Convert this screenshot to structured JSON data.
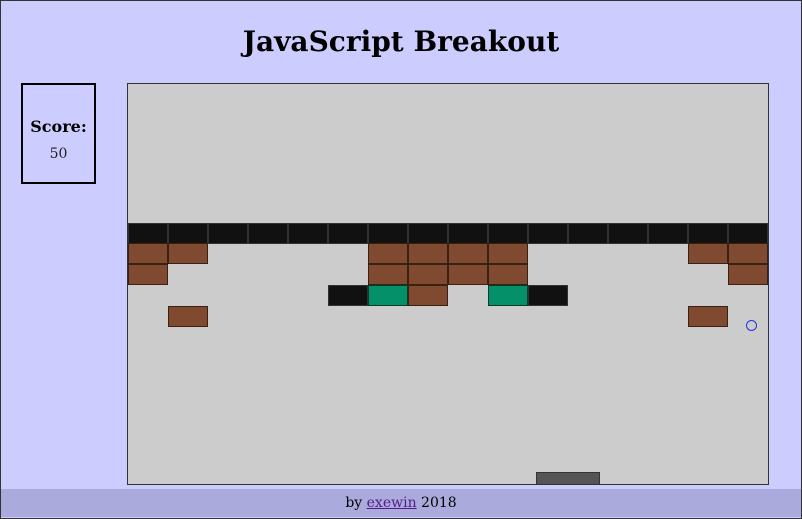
{
  "page": {
    "title": "JavaScript Breakout"
  },
  "score": {
    "label": "Score:",
    "value": "50"
  },
  "game": {
    "board": {
      "columns": 16,
      "brick_rows": [
        [
          "black",
          "black",
          "black",
          "black",
          "black",
          "black",
          "black",
          "black",
          "black",
          "black",
          "black",
          "black",
          "black",
          "black",
          "black",
          "black"
        ],
        [
          "brown",
          "brown",
          "",
          "",
          "",
          "",
          "brown",
          "brown",
          "brown",
          "brown",
          "",
          "",
          "",
          "",
          "brown",
          "brown"
        ],
        [
          "brown",
          "",
          "",
          "",
          "",
          "",
          "brown",
          "brown",
          "brown",
          "brown",
          "",
          "",
          "",
          "",
          "",
          "brown"
        ],
        [
          "",
          "",
          "",
          "",
          "",
          "black",
          "green",
          "brown",
          "",
          "green",
          "black",
          "",
          "",
          "",
          "",
          ""
        ],
        [
          "",
          "brown",
          "",
          "",
          "",
          "",
          "",
          "",
          "",
          "",
          "",
          "",
          "",
          "",
          "brown",
          ""
        ]
      ]
    },
    "colors": {
      "black": "#111111",
      "brown": "#7f4a2f",
      "green": "#049068",
      "background": "#cccccc",
      "paddle": "#555555",
      "ball": "#2233dd"
    }
  },
  "footer": {
    "prefix": "by",
    "author": "exewin",
    "year": "2018"
  }
}
